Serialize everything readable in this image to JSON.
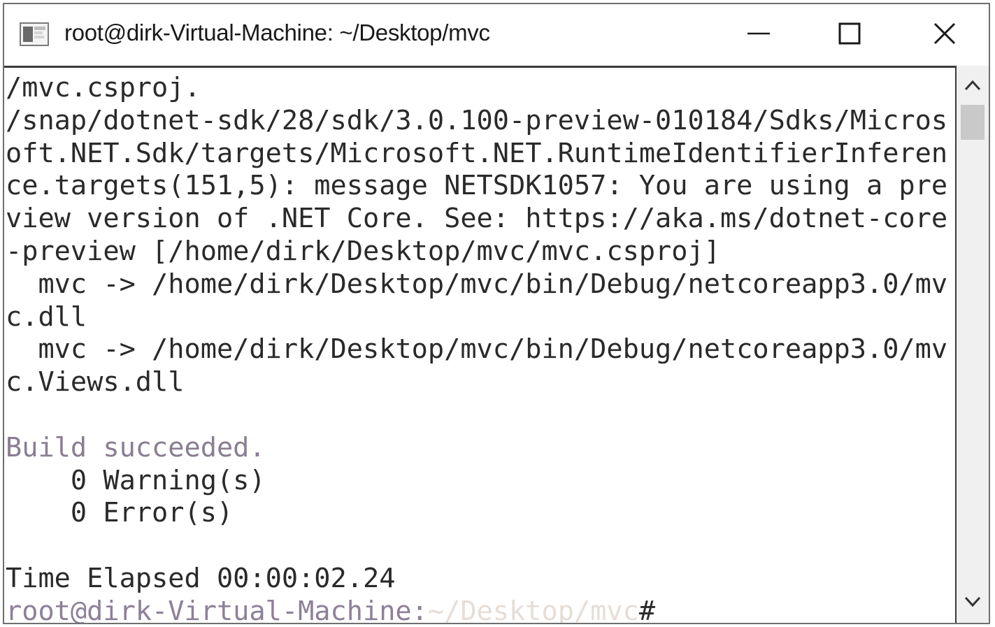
{
  "window": {
    "title": "root@dirk-Virtual-Machine: ~/Desktop/mvc",
    "icon": "terminal-icon",
    "controls": {
      "minimize": "minimize-icon",
      "maximize": "maximize-icon",
      "close": "close-icon"
    }
  },
  "terminal": {
    "lines": [
      "/mvc.csproj.",
      "/snap/dotnet-sdk/28/sdk/3.0.100-preview-010184/Sdks/Micros",
      "oft.NET.Sdk/targets/Microsoft.NET.RuntimeIdentifierInferen",
      "ce.targets(151,5): message NETSDK1057: You are using a pre",
      "view version of .NET Core. See: https://aka.ms/dotnet-core",
      "-preview [/home/dirk/Desktop/mvc/mvc.csproj]",
      "  mvc -> /home/dirk/Desktop/mvc/bin/Debug/netcoreapp3.0/mv",
      "c.dll",
      "  mvc -> /home/dirk/Desktop/mvc/bin/Debug/netcoreapp3.0/mv",
      "c.Views.dll",
      "",
      "Build succeeded.",
      "    0 Warning(s)",
      "    0 Error(s)",
      "",
      "Time Elapsed 00:00:02.24"
    ],
    "prompt": {
      "user_host": "root@dirk-Virtual-Machine",
      "separator": ":",
      "path": "~/Desktop/mvc",
      "symbol": "#"
    }
  },
  "colors": {
    "text": "#2a2a2a",
    "build_succeeded": "#8a7d92",
    "prompt_user": "#8d8098",
    "prompt_path": "#e6ddd8",
    "border": "#6f6f6f",
    "scrollbar_track": "#f0f0f0",
    "scrollbar_thumb": "#c9c9c9"
  }
}
